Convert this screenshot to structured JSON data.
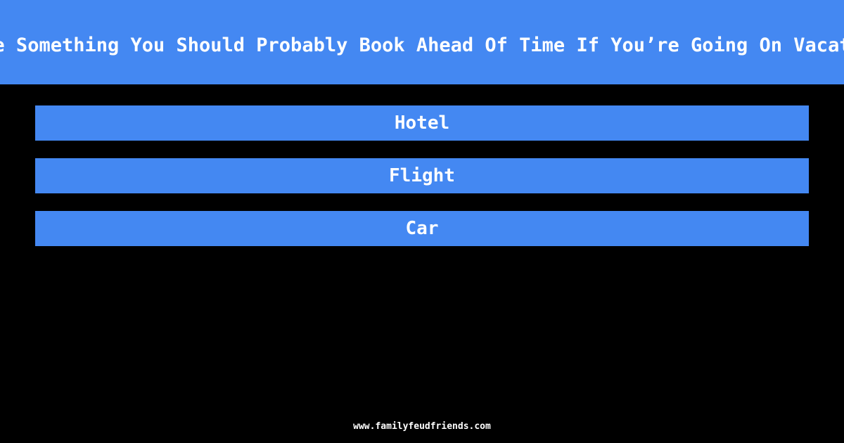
{
  "question": "Name Something You Should Probably Book Ahead Of Time If You’re Going On Vacation",
  "answers": [
    {
      "label": "Hotel"
    },
    {
      "label": "Flight"
    },
    {
      "label": "Car"
    }
  ],
  "footer": {
    "url": "www.familyfeudfriends.com"
  },
  "colors": {
    "accent": "#4488f2",
    "background": "#000000",
    "text": "#ffffff"
  }
}
